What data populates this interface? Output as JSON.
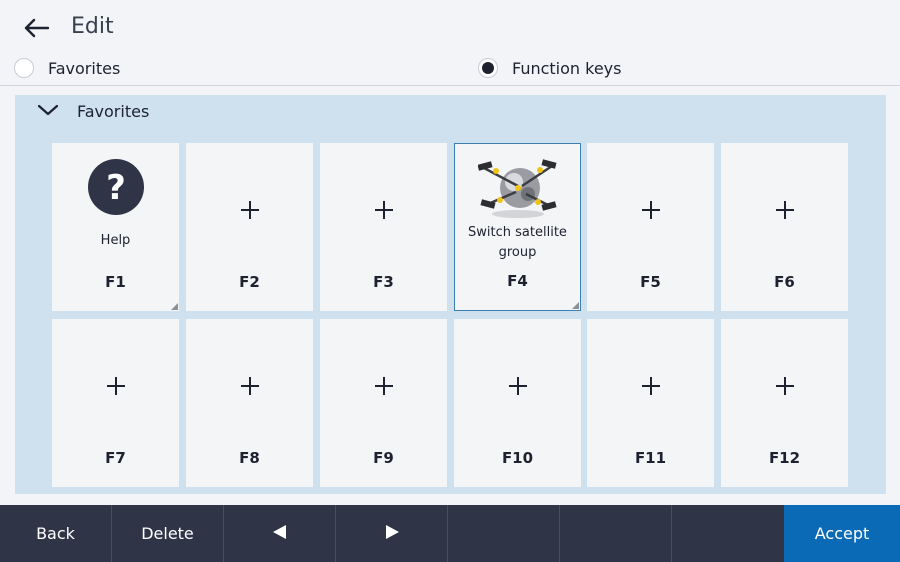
{
  "header": {
    "title": "Edit",
    "back_icon": "arrow-left-icon"
  },
  "mode": {
    "options": [
      {
        "label": "Favorites",
        "checked": false
      },
      {
        "label": "Function keys",
        "checked": true
      }
    ]
  },
  "panel": {
    "title": "Favorites",
    "expanded": true,
    "keys": [
      {
        "fn": "F1",
        "name": "Help",
        "icon": "help-icon",
        "assigned": true
      },
      {
        "fn": "F2",
        "name": "",
        "icon": "plus-icon",
        "assigned": false
      },
      {
        "fn": "F3",
        "name": "",
        "icon": "plus-icon",
        "assigned": false
      },
      {
        "fn": "F4",
        "name": "Switch satellite group",
        "icon": "satellite-icon",
        "assigned": true,
        "selected": true
      },
      {
        "fn": "F5",
        "name": "",
        "icon": "plus-icon",
        "assigned": false
      },
      {
        "fn": "F6",
        "name": "",
        "icon": "plus-icon",
        "assigned": false
      },
      {
        "fn": "F7",
        "name": "",
        "icon": "plus-icon",
        "assigned": false
      },
      {
        "fn": "F8",
        "name": "",
        "icon": "plus-icon",
        "assigned": false
      },
      {
        "fn": "F9",
        "name": "",
        "icon": "plus-icon",
        "assigned": false
      },
      {
        "fn": "F10",
        "name": "",
        "icon": "plus-icon",
        "assigned": false
      },
      {
        "fn": "F11",
        "name": "",
        "icon": "plus-icon",
        "assigned": false
      },
      {
        "fn": "F12",
        "name": "",
        "icon": "plus-icon",
        "assigned": false
      }
    ]
  },
  "toolbar": {
    "back_label": "Back",
    "delete_label": "Delete",
    "prev_icon": "triangle-left-icon",
    "next_icon": "triangle-right-icon",
    "accept_label": "Accept"
  },
  "colors": {
    "panel_bg": "#cfe0ee",
    "toolbar_bg": "#2f3447",
    "accent": "#0a6ab6",
    "selected_border": "#3f7fb0"
  }
}
